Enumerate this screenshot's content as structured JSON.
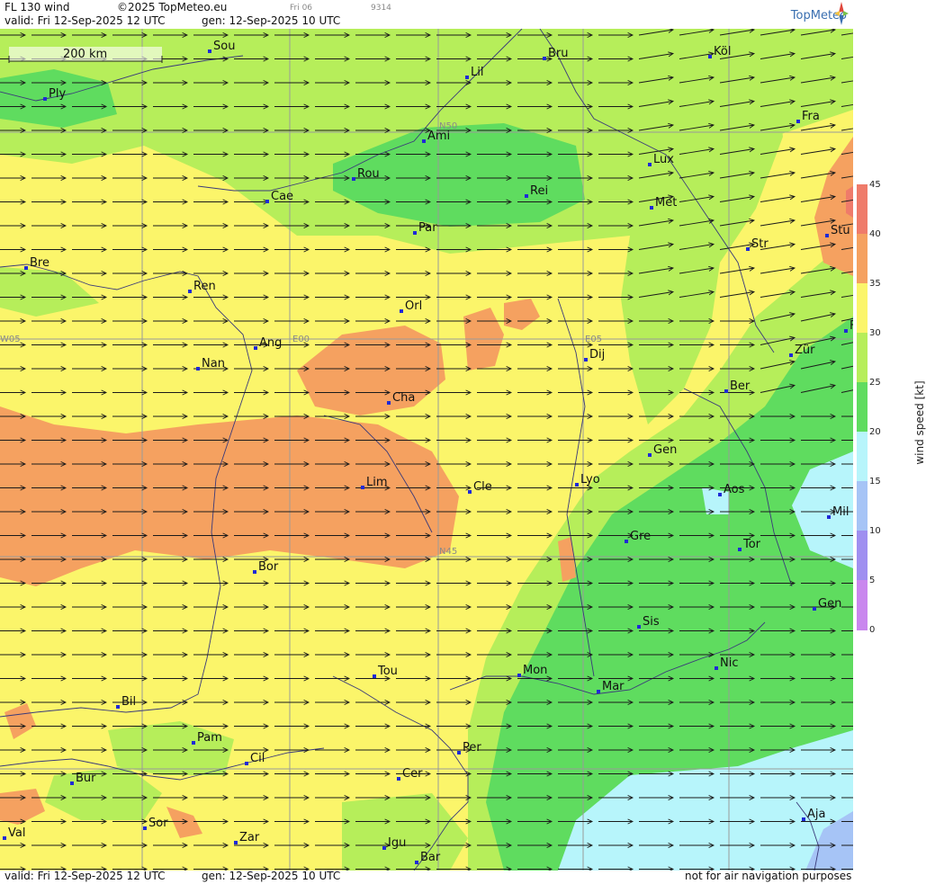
{
  "header": {
    "title": "FL 130 wind",
    "copyright": "©2025 TopMeteo.eu",
    "time_small": "Fri 06",
    "code_small": "9314",
    "valid": "valid:  Fri  12-Sep-2025  12 UTC",
    "gen": "gen: 12-Sep-2025 10 UTC",
    "logo": "TopMeteo"
  },
  "footer": {
    "valid": "valid:  Fri  12-Sep-2025  12 UTC",
    "gen": "gen: 12-Sep-2025 10 UTC",
    "disclaimer": "not for air navigation purposes"
  },
  "scale_bar": {
    "label": "200 km"
  },
  "grid_labels": [
    "N50",
    "N45",
    "W05",
    "E00",
    "E05"
  ],
  "cities": [
    {
      "name": "Sou"
    },
    {
      "name": "Bru"
    },
    {
      "name": "Köl"
    },
    {
      "name": "Ply"
    },
    {
      "name": "Lil"
    },
    {
      "name": "Fra"
    },
    {
      "name": "Ami"
    },
    {
      "name": "Lux"
    },
    {
      "name": "Rou"
    },
    {
      "name": "Cae"
    },
    {
      "name": "Rei"
    },
    {
      "name": "Met"
    },
    {
      "name": "Par"
    },
    {
      "name": "Stu"
    },
    {
      "name": "Str"
    },
    {
      "name": "Bre"
    },
    {
      "name": "Ren"
    },
    {
      "name": "Orl"
    },
    {
      "name": "Ang"
    },
    {
      "name": "Dij"
    },
    {
      "name": "Zür"
    },
    {
      "name": "Nan"
    },
    {
      "name": "Ber"
    },
    {
      "name": "Cha"
    },
    {
      "name": "Gen"
    },
    {
      "name": "Lim"
    },
    {
      "name": "Lyo"
    },
    {
      "name": "Cle"
    },
    {
      "name": "Aos"
    },
    {
      "name": "Mil"
    },
    {
      "name": "Gre"
    },
    {
      "name": "Tor"
    },
    {
      "name": "Bor"
    },
    {
      "name": "Gen"
    },
    {
      "name": "Sis"
    },
    {
      "name": "Tou"
    },
    {
      "name": "Mon"
    },
    {
      "name": "Nic"
    },
    {
      "name": "Mar"
    },
    {
      "name": "Bil"
    },
    {
      "name": "Pam"
    },
    {
      "name": "Per"
    },
    {
      "name": "Cil"
    },
    {
      "name": "Bur"
    },
    {
      "name": "Cer"
    },
    {
      "name": "Sor"
    },
    {
      "name": "Aja"
    },
    {
      "name": "Val"
    },
    {
      "name": "Zar"
    },
    {
      "name": "Igu"
    },
    {
      "name": "Bar"
    },
    {
      "name": "F"
    }
  ],
  "legend": {
    "unit": "wind speed [kt]",
    "ticks": [
      "45",
      "40",
      "35",
      "30",
      "25",
      "20",
      "15",
      "10",
      "5",
      "0"
    ],
    "colors": {
      "0_5": "#c987ee",
      "5_10": "#9f8ff0",
      "10_15": "#a6c4f6",
      "15_20": "#b7f5fb",
      "20_25": "#5fdc5f",
      "25_30": "#b6ee5a",
      "30_35": "#fbf56a",
      "35_40": "#f5a160",
      "40_45": "#ef7b6a"
    }
  },
  "wind": {
    "direction_deg": 270,
    "speed_level_kt": 30
  }
}
